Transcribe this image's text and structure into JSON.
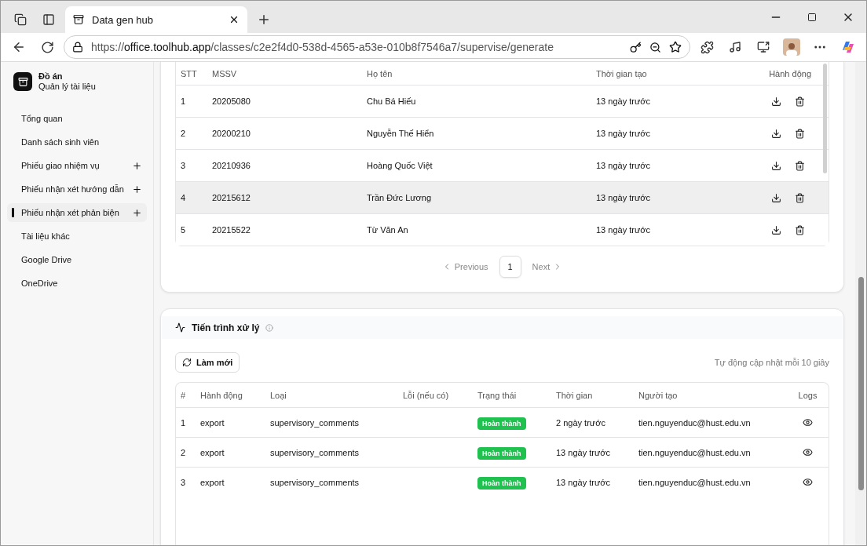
{
  "browser": {
    "tabs": [
      {
        "title": "Data gen hub",
        "selected": true
      }
    ],
    "url": {
      "scheme": "https://",
      "host": "office.toolhub.app",
      "path": "/classes/c2e2f4d0-538d-4565-a53e-010b8f7546a7/supervise/generate"
    }
  },
  "sidebar": {
    "brand": {
      "title": "Đồ án",
      "subtitle": "Quản lý tài liệu"
    },
    "items": [
      {
        "label": "Tổng quan",
        "selected": false,
        "addable": false
      },
      {
        "label": "Danh sách sinh viên",
        "selected": false,
        "addable": false
      },
      {
        "label": "Phiếu giao nhiệm vụ",
        "selected": false,
        "addable": true
      },
      {
        "label": "Phiếu nhận xét hướng dẫn",
        "selected": false,
        "addable": true
      },
      {
        "label": "Phiếu nhận xét phản biện",
        "selected": true,
        "addable": true
      },
      {
        "label": "Tài liệu khác",
        "selected": false,
        "addable": false
      },
      {
        "label": "Google Drive",
        "selected": false,
        "addable": false
      },
      {
        "label": "OneDrive",
        "selected": false,
        "addable": false
      }
    ]
  },
  "documents": {
    "columns": [
      "STT",
      "MSSV",
      "Họ tên",
      "Thời gian tạo",
      "Hành động"
    ],
    "rows": [
      {
        "stt": "1",
        "mssv": "20205080",
        "name": "Chu Bá Hiếu",
        "created": "13 ngày trước",
        "highlighted": false
      },
      {
        "stt": "2",
        "mssv": "20200210",
        "name": "Nguyễn Thế Hiển",
        "created": "13 ngày trước",
        "highlighted": false
      },
      {
        "stt": "3",
        "mssv": "20210936",
        "name": "Hoàng Quốc Việt",
        "created": "13 ngày trước",
        "highlighted": false
      },
      {
        "stt": "4",
        "mssv": "20215612",
        "name": "Trần Đức Lương",
        "created": "13 ngày trước",
        "highlighted": true
      },
      {
        "stt": "5",
        "mssv": "20215522",
        "name": "Từ Văn An",
        "created": "13 ngày trước",
        "highlighted": false
      }
    ],
    "pagination": {
      "previous": "Previous",
      "pages": [
        {
          "label": "1",
          "selected": true
        }
      ],
      "next": "Next"
    }
  },
  "process": {
    "title": "Tiến trình xử lý",
    "refresh": "Làm mới",
    "auto_note": "Tự động cập nhật mỗi 10 giây",
    "columns": [
      "#",
      "Hành động",
      "Loại",
      "Lỗi (nếu có)",
      "Trạng thái",
      "Thời gian",
      "Người tạo",
      "Logs"
    ],
    "rows": [
      {
        "index": "1",
        "action": "export",
        "type": "supervisory_comments",
        "status": "Hoàn thành",
        "time": "2 ngày trước",
        "creator": "tien.nguyenduc@hust.edu.vn"
      },
      {
        "index": "2",
        "action": "export",
        "type": "supervisory_comments",
        "status": "Hoàn thành",
        "time": "13 ngày trước",
        "creator": "tien.nguyenduc@hust.edu.vn"
      },
      {
        "index": "3",
        "action": "export",
        "type": "supervisory_comments",
        "status": "Hoàn thành",
        "time": "13 ngày trước",
        "creator": "tien.nguyenduc@hust.edu.vn"
      }
    ]
  }
}
